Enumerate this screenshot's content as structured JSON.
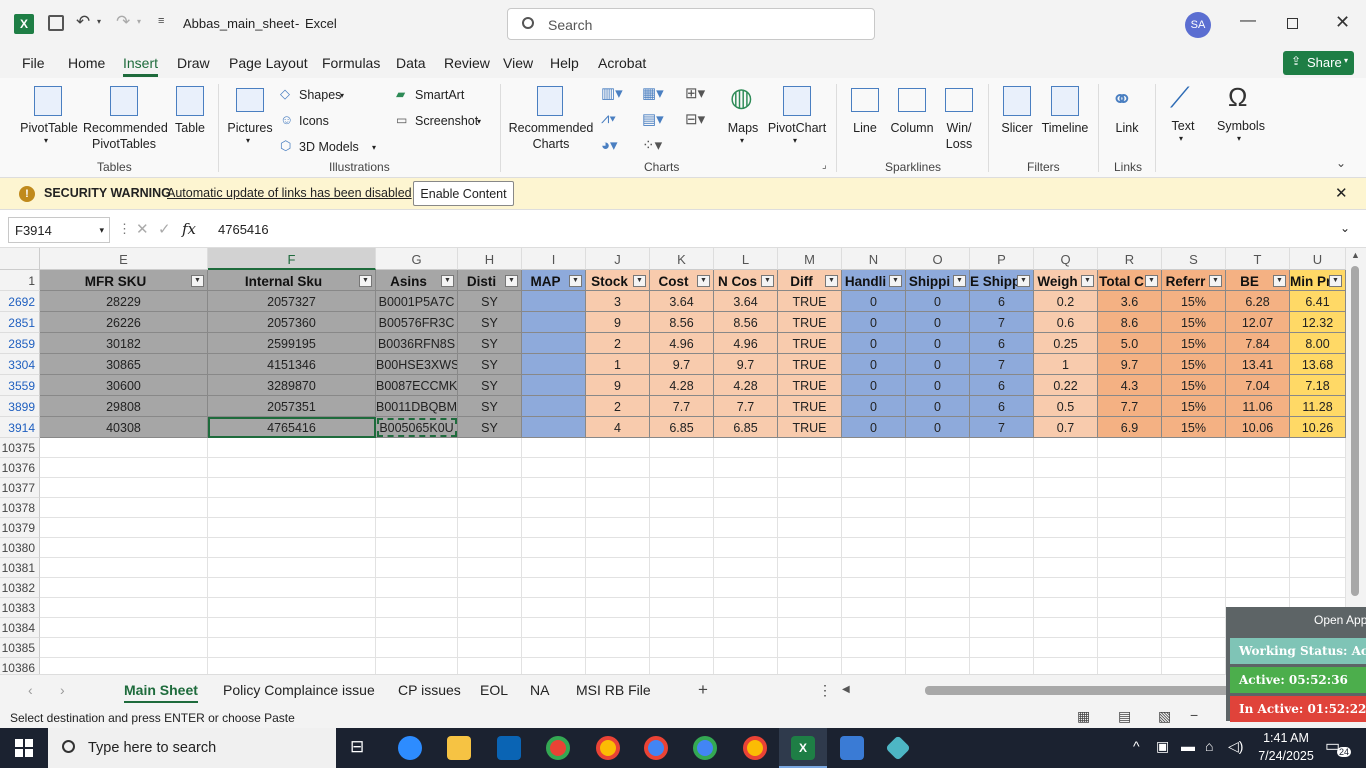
{
  "titlebar": {
    "file_name": "Abbas_main_sheet",
    "app_name": "Excel",
    "search_placeholder": "Search",
    "avatar_initials": "SA"
  },
  "menu": {
    "tabs": [
      "File",
      "Home",
      "Insert",
      "Draw",
      "Page Layout",
      "Formulas",
      "Data",
      "Review",
      "View",
      "Help",
      "Acrobat"
    ],
    "active": "Insert",
    "share_label": "Share"
  },
  "ribbon": {
    "pivot_table": "PivotTable",
    "recommended_pivot_1": "Recommended",
    "recommended_pivot_2": "PivotTables",
    "table": "Table",
    "tables_group": "Tables",
    "pictures": "Pictures",
    "shapes": "Shapes",
    "icons": "Icons",
    "models_3d": "3D Models",
    "smartart": "SmartArt",
    "screenshot": "Screenshot",
    "illustrations_group": "Illustrations",
    "recommended_charts_1": "Recommended",
    "recommended_charts_2": "Charts",
    "maps": "Maps",
    "pivotchart": "PivotChart",
    "charts_group": "Charts",
    "line": "Line",
    "column": "Column",
    "winloss_1": "Win/",
    "winloss_2": "Loss",
    "sparklines_group": "Sparklines",
    "slicer": "Slicer",
    "timeline": "Timeline",
    "filters_group": "Filters",
    "link": "Link",
    "links_group": "Links",
    "text": "Text",
    "symbols": "Symbols"
  },
  "security": {
    "title": "SECURITY WARNING",
    "message": "Automatic update of links has been disabled",
    "button": "Enable Content"
  },
  "formula_bar": {
    "name_box": "F3914",
    "fx": "fx",
    "value": "4765416"
  },
  "columns": [
    "E",
    "F",
    "G",
    "H",
    "I",
    "J",
    "K",
    "L",
    "M",
    "N",
    "O",
    "P",
    "Q",
    "R",
    "S",
    "T",
    "U"
  ],
  "header_row_number": "1",
  "headers": [
    "MFR SKU",
    "Internal Sku",
    "Asins",
    "Disti",
    "MAP",
    "Stock",
    "Cost",
    "N Cos",
    "Diff",
    "Handli",
    "Shippi",
    "E Shipp",
    "Weigh",
    "Total C",
    "Referr",
    "BE",
    "Min Pri"
  ],
  "rows": [
    {
      "row": "2692",
      "cells": [
        "28229",
        "2057327",
        "B0001P5A7C",
        "SY",
        "",
        "3",
        "3.64",
        "3.64",
        "TRUE",
        "0",
        "0",
        "6",
        "0.2",
        "3.6",
        "15%",
        "6.28",
        "6.41"
      ]
    },
    {
      "row": "2851",
      "cells": [
        "26226",
        "2057360",
        "B00576FR3C",
        "SY",
        "",
        "9",
        "8.56",
        "8.56",
        "TRUE",
        "0",
        "0",
        "7",
        "0.6",
        "8.6",
        "15%",
        "12.07",
        "12.32"
      ]
    },
    {
      "row": "2859",
      "cells": [
        "30182",
        "2599195",
        "B0036RFN8S",
        "SY",
        "",
        "2",
        "4.96",
        "4.96",
        "TRUE",
        "0",
        "0",
        "6",
        "0.25",
        "5.0",
        "15%",
        "7.84",
        "8.00"
      ]
    },
    {
      "row": "3304",
      "cells": [
        "30865",
        "4151346",
        "B00HSE3XWS",
        "SY",
        "",
        "1",
        "9.7",
        "9.7",
        "TRUE",
        "0",
        "0",
        "7",
        "1",
        "9.7",
        "15%",
        "13.41",
        "13.68"
      ]
    },
    {
      "row": "3559",
      "cells": [
        "30600",
        "3289870",
        "B0087ECCMK",
        "SY",
        "",
        "9",
        "4.28",
        "4.28",
        "TRUE",
        "0",
        "0",
        "6",
        "0.22",
        "4.3",
        "15%",
        "7.04",
        "7.18"
      ]
    },
    {
      "row": "3899",
      "cells": [
        "29808",
        "2057351",
        "B0011DBQBM",
        "SY",
        "",
        "2",
        "7.7",
        "7.7",
        "TRUE",
        "0",
        "0",
        "6",
        "0.5",
        "7.7",
        "15%",
        "11.06",
        "11.28"
      ]
    },
    {
      "row": "3914",
      "cells": [
        "40308",
        "4765416",
        "B005065K0U",
        "SY",
        "",
        "4",
        "6.85",
        "6.85",
        "TRUE",
        "0",
        "0",
        "7",
        "0.7",
        "6.9",
        "15%",
        "10.06",
        "10.26"
      ]
    }
  ],
  "empty_rows": [
    "10375",
    "10376",
    "10377",
    "10378",
    "10379",
    "10380",
    "10381",
    "10382",
    "10383",
    "10384",
    "10385",
    "10386"
  ],
  "column_fills": [
    "#a6a6a6",
    "#a6a6a6",
    "#a6a6a6",
    "#a6a6a6",
    "#8eaadb",
    "#f8cbad",
    "#f8cbad",
    "#f8cbad",
    "#f8cbad",
    "#8eaadb",
    "#8eaadb",
    "#8eaadb",
    "#f8cbad",
    "#f4b183",
    "#f4b183",
    "#f4b183",
    "#ffd966"
  ],
  "sheet_tabs": [
    "Main Sheet",
    "Policy Complaince issue",
    "CP issues",
    "EOL",
    "NA",
    "MSI RB File"
  ],
  "active_sheet": "Main Sheet",
  "status_text": "Select destination and press ENTER or choose Paste",
  "overlay": {
    "open_app": "Open App",
    "working_status": "Working Status: Active",
    "active": "Active: 05:52:36",
    "inactive": "In Active: 01:52:22"
  },
  "taskbar": {
    "search_placeholder": "Type here to search",
    "time": "1:41 AM",
    "date": "7/24/2025",
    "notification_count": "24"
  }
}
